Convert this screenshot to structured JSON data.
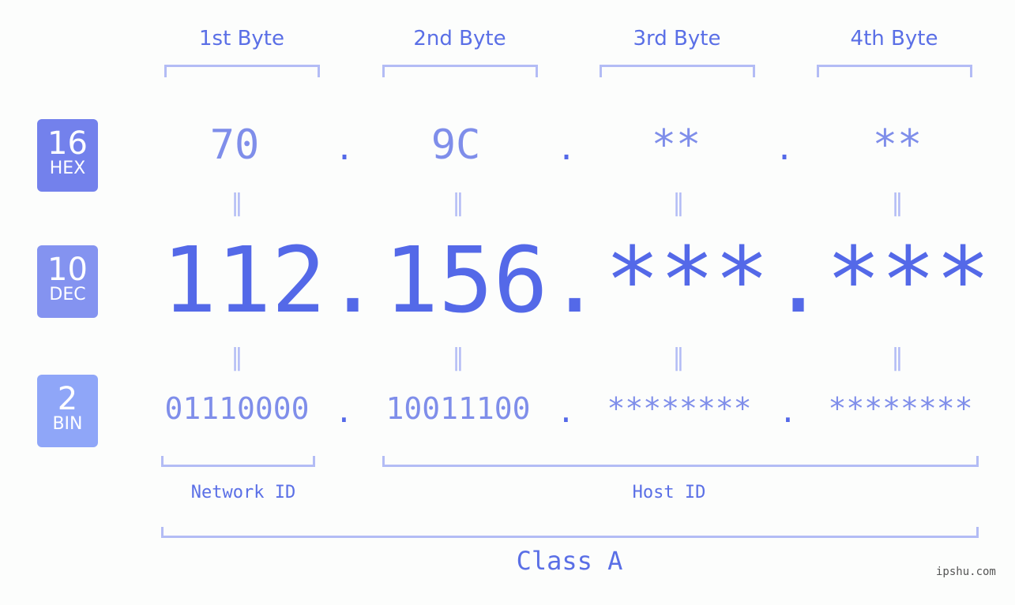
{
  "byte_headers": [
    "1st Byte",
    "2nd Byte",
    "3rd Byte",
    "4th Byte"
  ],
  "badges": {
    "hex": {
      "num": "16",
      "label": "HEX",
      "color": "#7381ec"
    },
    "dec": {
      "num": "10",
      "label": "DEC",
      "color": "#8493f0"
    },
    "bin": {
      "num": "2",
      "label": "BIN",
      "color": "#8fa6f8"
    }
  },
  "hex_values": [
    "70",
    "9C",
    "**",
    "**"
  ],
  "dec_values": [
    "112",
    "156",
    "***",
    "***"
  ],
  "bin_values": [
    "01110000",
    "10011100",
    "********",
    "********"
  ],
  "separator": ".",
  "equals_sign": "=",
  "network_label": "Network ID",
  "host_label": "Host ID",
  "class_label": "Class A",
  "watermark": "ipshu.com",
  "colors": {
    "accent": "#5469e8",
    "light": "#7f8eea",
    "bracket": "#b3bcf5"
  }
}
